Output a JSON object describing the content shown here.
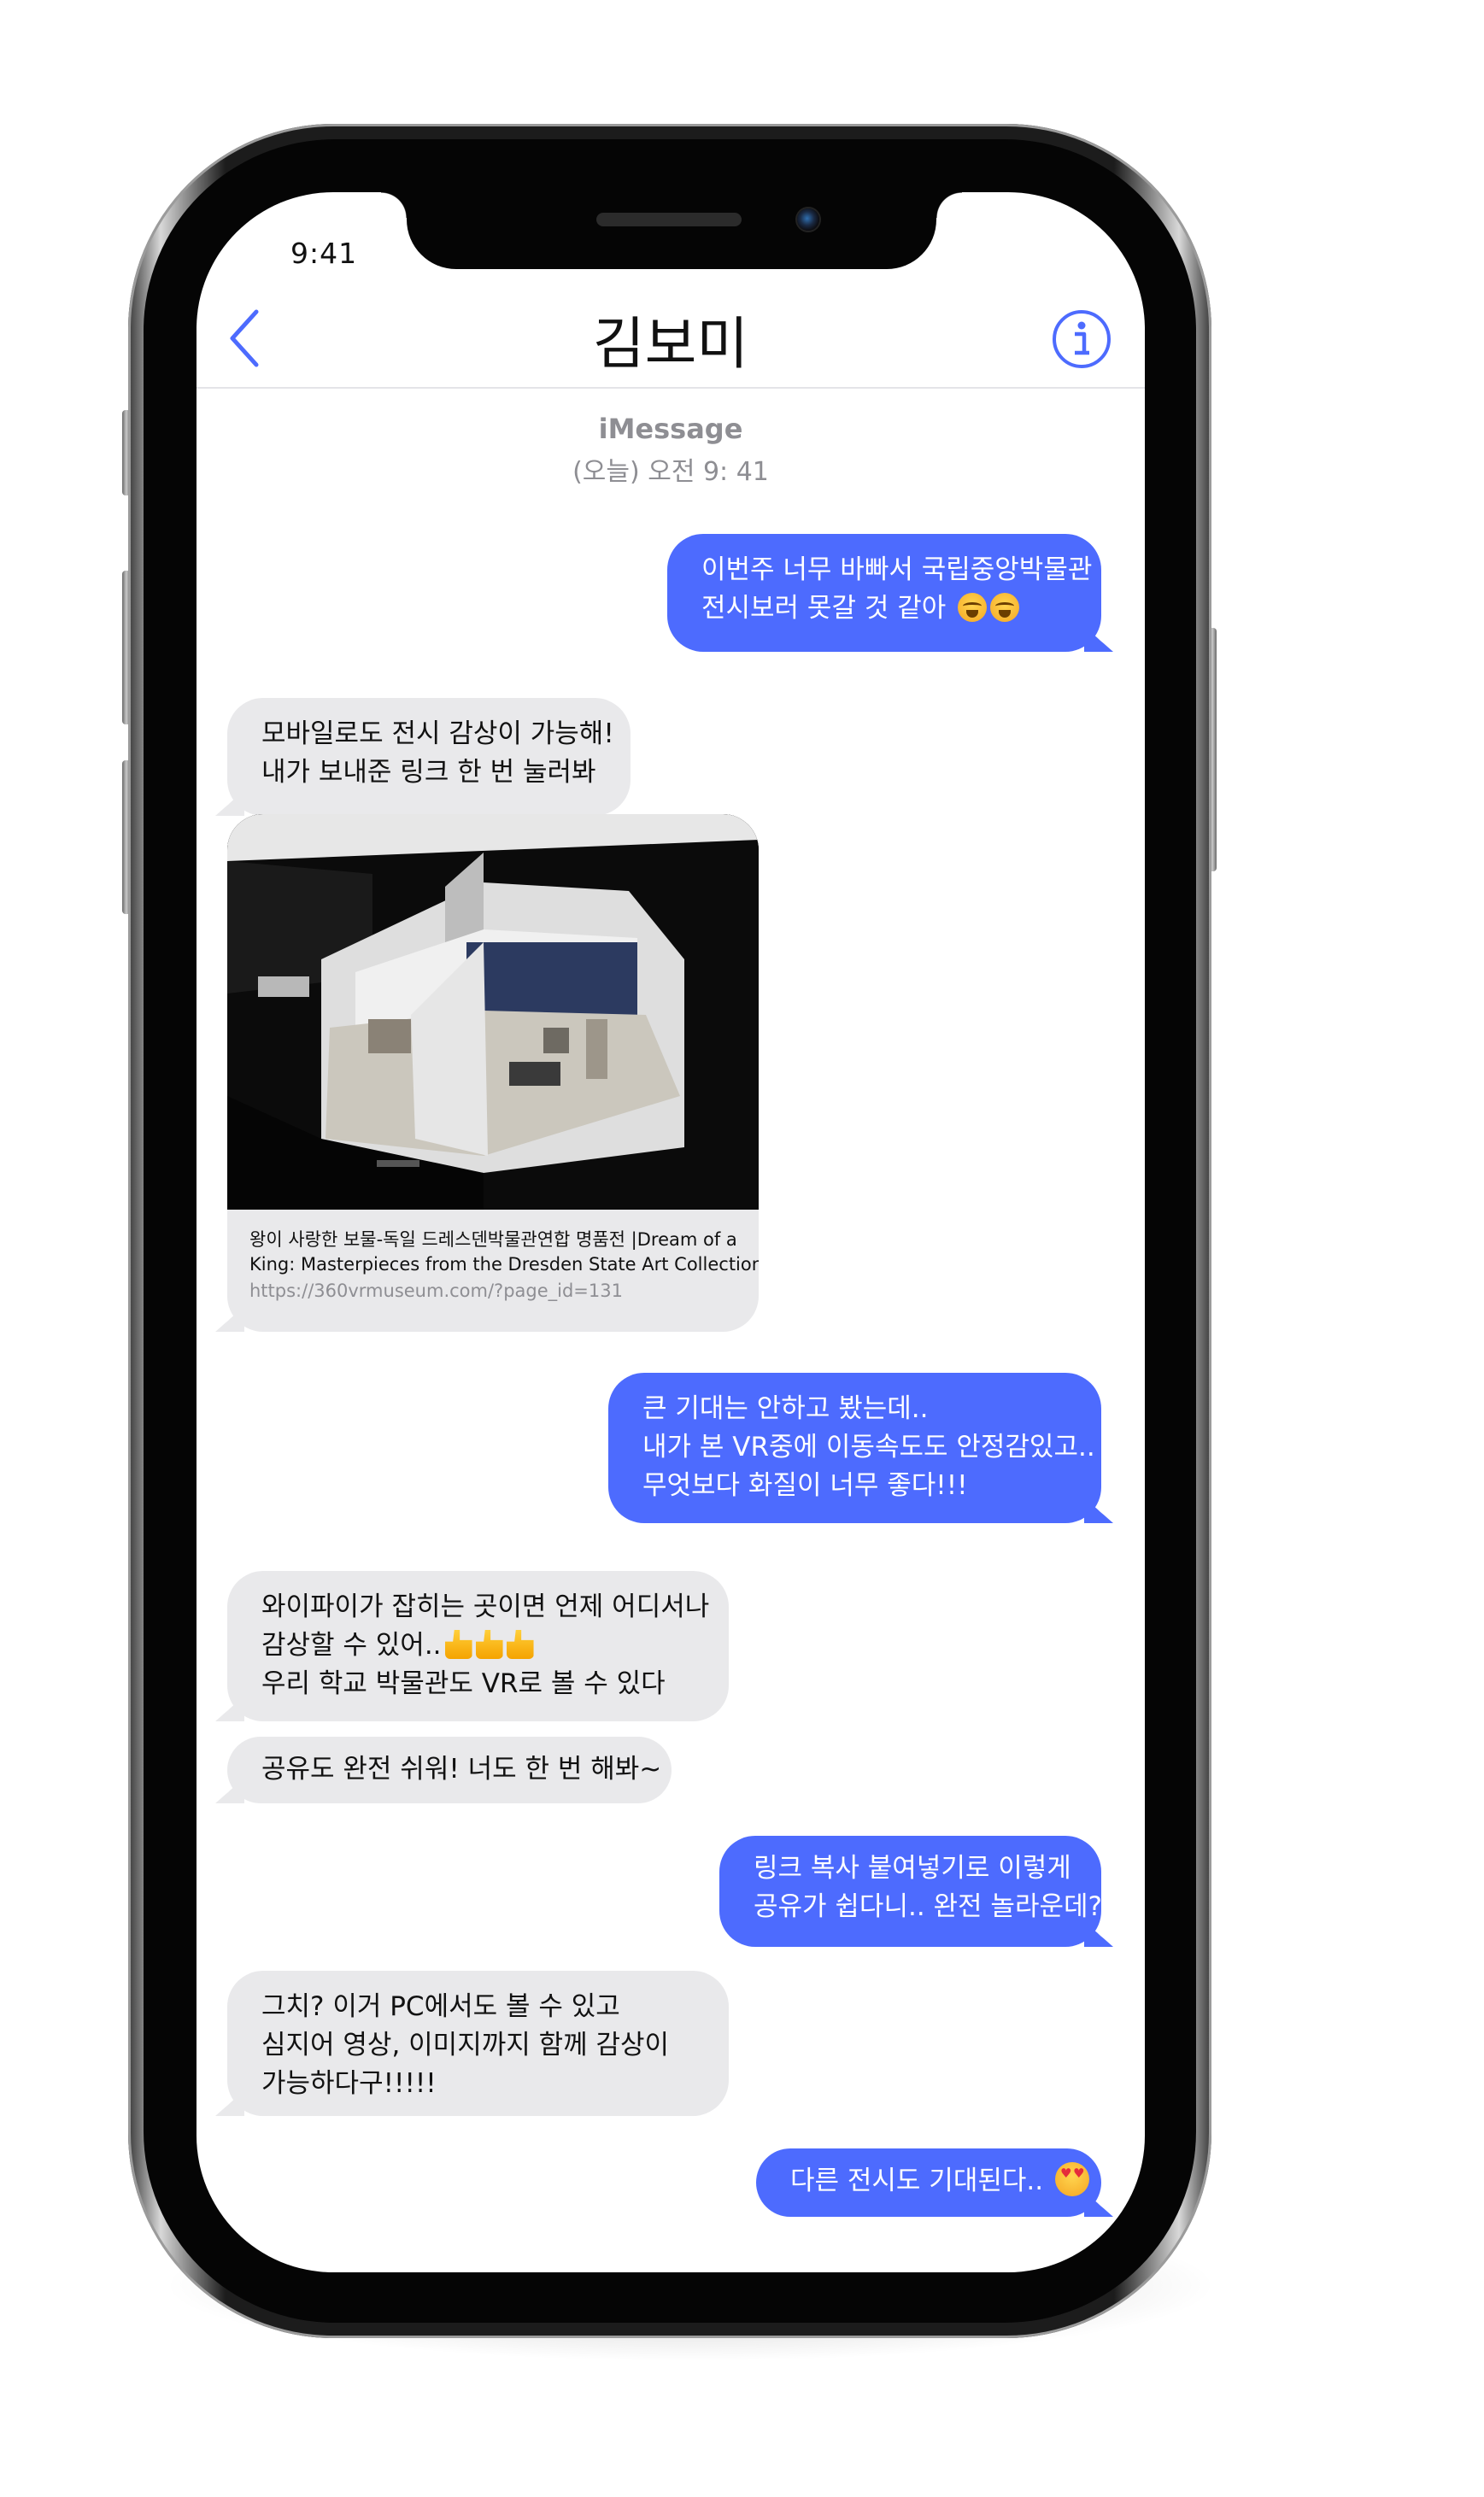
{
  "status_bar": {
    "time": "9:41"
  },
  "header": {
    "contact_name": "김보미"
  },
  "thread_meta": {
    "service": "iMessage",
    "timestamp": "(오늘) 오전 9: 41"
  },
  "messages": [
    {
      "direction": "sent",
      "lines": [
        "이번주 너무 바빠서 국립중앙박물관",
        "전시보러 못갈 것 같아 "
      ],
      "emoji": [
        "crying-face",
        "crying-face"
      ]
    },
    {
      "direction": "received",
      "lines": [
        "모바일로도 전시 감상이 가능해!",
        "내가 보내준 링크 한 번 눌러봐"
      ]
    },
    {
      "direction": "sent",
      "lines": [
        "큰 기대는 안하고 봤는데..",
        "내가 본 VR중에 이동속도도 안정감있고..",
        "무엇보다 화질이 너무 좋다!!!"
      ]
    },
    {
      "direction": "received",
      "lines": [
        "와이파이가 잡히는 곳이면 언제 어디서나",
        "감상할 수 있어..",
        "우리 학교 박물관도 VR로 볼 수 있다"
      ],
      "emoji": [
        "thumbs-up",
        "thumbs-up",
        "thumbs-up"
      ]
    },
    {
      "direction": "received",
      "lines": [
        "공유도 완전 쉬워! 너도 한 번 해봐~"
      ]
    },
    {
      "direction": "sent",
      "lines": [
        "링크 복사 붙여넣기로 이렇게",
        "공유가 쉽다니.. 완전 놀라운데?"
      ]
    },
    {
      "direction": "received",
      "lines": [
        "그치? 이거 PC에서도 볼 수 있고",
        "심지어 영상, 이미지까지 함께 감상이",
        "가능하다구!!!!!"
      ]
    },
    {
      "direction": "sent",
      "lines": [
        "다른 전시도 기대된다.. "
      ],
      "emoji": [
        "heart-eyes"
      ]
    }
  ],
  "link_preview": {
    "title_line1": "왕이 사랑한 보물-독일 드레스덴박물관연합 명품전 |Dream of a",
    "title_line2": "King: Masterpieces from the Dresden State Art Collections",
    "url": "https://360vrmuseum.com/?page_id=131",
    "image_subject": "3D virtual museum gallery"
  },
  "colors": {
    "sent_bubble": "#4d6bfe",
    "received_bubble": "#e9e9eb",
    "accent": "#4d6bfe",
    "meta_text": "#8e8e93"
  }
}
